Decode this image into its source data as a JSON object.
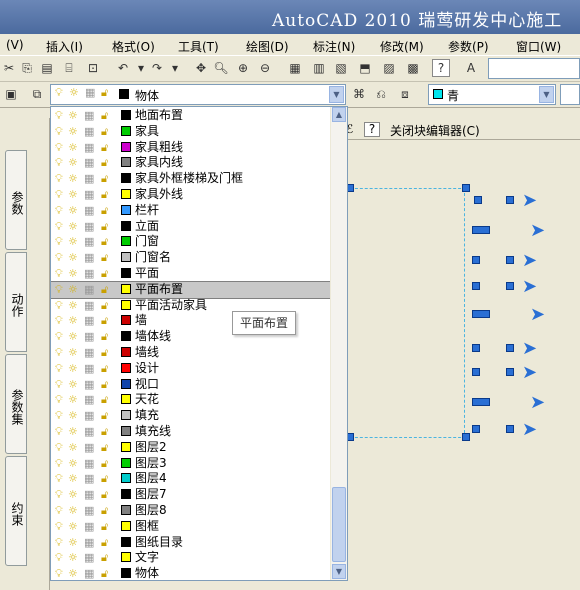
{
  "title": "AutoCAD 2010  瑞莺研发中心施工",
  "menu": [
    "(V)",
    "插入(I)",
    "格式(O)",
    "工具(T)",
    "绘图(D)",
    "标注(N)",
    "修改(M)",
    "参数(P)",
    "窗口(W)"
  ],
  "layer_selected": "物体",
  "color_selected": "青",
  "block_editor_close": "关闭块编辑器(C)",
  "side_tabs": [
    "参数",
    "动作",
    "参数集",
    "约束"
  ],
  "layers": [
    {
      "name": "地面布置",
      "color": "#000000"
    },
    {
      "name": "家具",
      "color": "#00cc00"
    },
    {
      "name": "家具粗线",
      "color": "#cc00cc"
    },
    {
      "name": "家具内线",
      "color": "#808080"
    },
    {
      "name": "家具外框楼梯及门框",
      "color": "#000000"
    },
    {
      "name": "家具外线",
      "color": "#ffff00"
    },
    {
      "name": "栏杆",
      "color": "#3399ff"
    },
    {
      "name": "立面",
      "color": "#000000"
    },
    {
      "name": "门窗",
      "color": "#00cc00"
    },
    {
      "name": "门窗名",
      "color": "#c0c0c0"
    },
    {
      "name": "平面",
      "color": "#000000"
    },
    {
      "name": "平面布置",
      "color": "#ffff00"
    },
    {
      "name": "平面活动家具",
      "color": "#ffff00"
    },
    {
      "name": "墙",
      "color": "#cc0000"
    },
    {
      "name": "墙体线",
      "color": "#000000"
    },
    {
      "name": "墙线",
      "color": "#cc0000"
    },
    {
      "name": "设计",
      "color": "#ff0000"
    },
    {
      "name": "视口",
      "color": "#1144aa"
    },
    {
      "name": "天花",
      "color": "#ffff00"
    },
    {
      "name": "填充",
      "color": "#c0c0c0"
    },
    {
      "name": "填充线",
      "color": "#808080"
    },
    {
      "name": "图层2",
      "color": "#ffff00"
    },
    {
      "name": "图层3",
      "color": "#00cc00"
    },
    {
      "name": "图层4",
      "color": "#00cccc"
    },
    {
      "name": "图层7",
      "color": "#000000"
    },
    {
      "name": "图层8",
      "color": "#808080"
    },
    {
      "name": "图框",
      "color": "#ffff00"
    },
    {
      "name": "图纸目录",
      "color": "#000000"
    },
    {
      "name": "文字",
      "color": "#ffff00"
    },
    {
      "name": "物体",
      "color": "#000000"
    }
  ],
  "selected_layer_index": 11,
  "tooltip": "平面布置",
  "colors": {
    "accent": "#2a6fd4",
    "cyan_swatch": "#00e5ee"
  }
}
